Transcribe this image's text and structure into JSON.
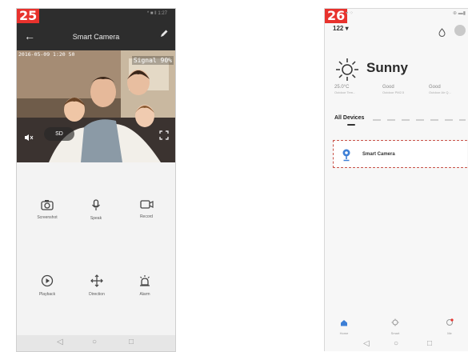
{
  "step_left": "25",
  "step_right": "26",
  "colors": {
    "step_badge": "#e8322d",
    "app_bar": "#2d2d2d",
    "accent_blue": "#3d7fd6",
    "highlight_border": "#c9544a"
  },
  "camera_screen": {
    "status_bar": "* ■ ‖ 1:27",
    "title": "Smart Camera",
    "back_icon": "back-arrow-icon",
    "edit_icon": "pencil-icon",
    "video": {
      "timestamp": "2016-05-09  1:20 50",
      "signal": "Signal 90%",
      "quality_button": "SD"
    },
    "controls": [
      {
        "label": "Screenshot",
        "icon": "camera-icon"
      },
      {
        "label": "Speak",
        "icon": "microphone-icon"
      },
      {
        "label": "Record",
        "icon": "video-record-icon"
      },
      {
        "label": "Playback",
        "icon": "playback-icon"
      },
      {
        "label": "Direction",
        "icon": "direction-icon"
      },
      {
        "label": "Alarm",
        "icon": "alarm-icon"
      }
    ]
  },
  "home_screen": {
    "status_bar_left": "▾ ⁘",
    "status_bar_right": "⊕ ▬▮",
    "home_selector": "122 ▾",
    "weather": "Sunny",
    "stats": [
      {
        "value": "25.0°C",
        "label": "Outdoor Tem..."
      },
      {
        "value": "Good",
        "label": "Outdoor PM2.5"
      },
      {
        "value": "Good",
        "label": "Outdoor Air Q..."
      }
    ],
    "active_tab": "All Devices",
    "device": {
      "name": "Smart Camera",
      "icon": "camera-device-icon"
    },
    "tabbar": [
      {
        "label": "Home",
        "icon": "home-icon"
      },
      {
        "label": "Smart",
        "icon": "smart-icon"
      },
      {
        "label": "Me",
        "icon": "me-icon"
      }
    ]
  }
}
